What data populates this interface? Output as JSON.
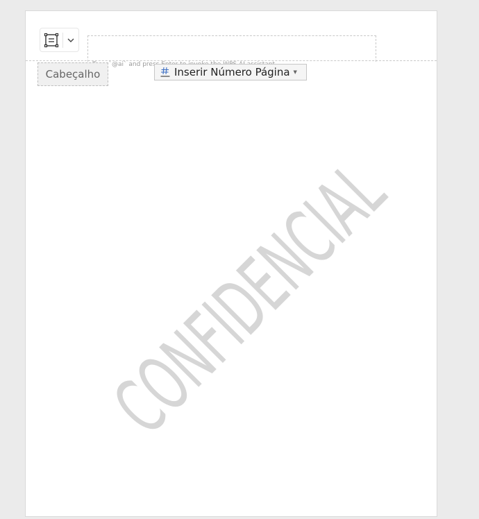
{
  "header": {
    "tag_label": "Cabeçalho",
    "ai_hint": "Type `@ai` and press Enter to invoke the WPS AI assistant",
    "insert_page_number_label": "Inserir Número Página"
  },
  "watermark": {
    "text": "CONFIDENCIAL",
    "color": "#d6d6d6"
  },
  "icons": {
    "header_layout": "header-layout-icon",
    "dropdown": "chevron-down-icon",
    "page_number": "page-number-hash-icon"
  }
}
